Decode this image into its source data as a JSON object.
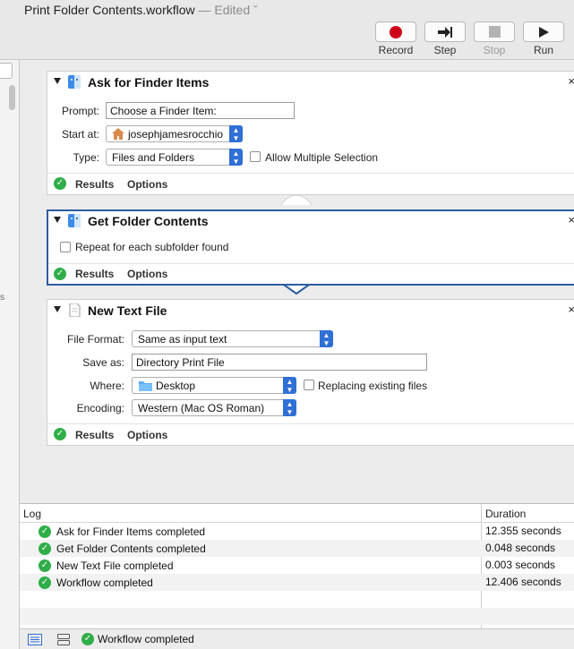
{
  "window": {
    "title": "Print Folder Contents.workflow",
    "edited": " — Edited ˇ"
  },
  "toolbar": {
    "record": "Record",
    "step": "Step",
    "stop": "Stop",
    "run": "Run"
  },
  "actions": {
    "ask": {
      "title": "Ask for Finder Items",
      "prompt_label": "Prompt:",
      "prompt_value": "Choose a Finder Item:",
      "start_label": "Start at:",
      "start_value": "josephjamesrocchio",
      "type_label": "Type:",
      "type_value": "Files and Folders",
      "allow_multiple": "Allow Multiple Selection",
      "results": "Results",
      "options": "Options"
    },
    "get": {
      "title": "Get Folder Contents",
      "repeat": "Repeat for each subfolder found",
      "results": "Results",
      "options": "Options"
    },
    "newtext": {
      "title": "New Text File",
      "format_label": "File Format:",
      "format_value": "Same as input text",
      "saveas_label": "Save as:",
      "saveas_value": "Directory Print File",
      "where_label": "Where:",
      "where_value": "Desktop",
      "replacing": "Replacing existing files",
      "encoding_label": "Encoding:",
      "encoding_value": "Western (Mac OS Roman)",
      "results": "Results",
      "options": "Options"
    }
  },
  "log": {
    "col_log": "Log",
    "col_duration": "Duration",
    "rows": [
      {
        "text": "Ask for Finder Items completed",
        "duration": "12.355 seconds"
      },
      {
        "text": "Get Folder Contents completed",
        "duration": "0.048 seconds"
      },
      {
        "text": "New Text File completed",
        "duration": "0.003 seconds"
      },
      {
        "text": "Workflow completed",
        "duration": "12.406 seconds"
      }
    ]
  },
  "statusbar": {
    "text": "Workflow completed"
  },
  "sidebar": {
    "edge_char": "s"
  },
  "colors": {
    "accent": "#2f6fd6",
    "selected_border": "#2d5d9f",
    "success": "#2fae48",
    "record": "#d0021b"
  },
  "icons": {
    "close": "×",
    "check": "✓",
    "home": "house-icon",
    "folder": "folder-icon"
  }
}
